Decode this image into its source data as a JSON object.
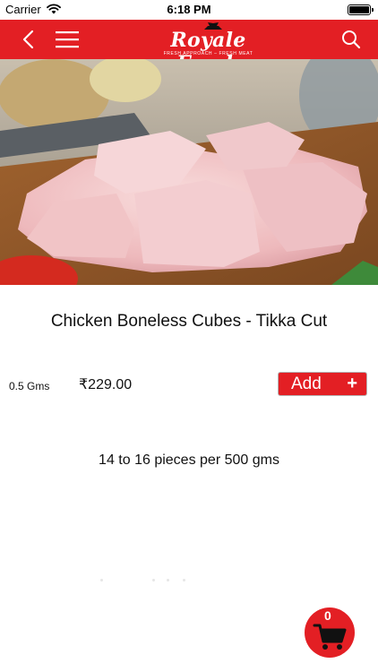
{
  "status_bar": {
    "carrier": "Carrier",
    "time": "6:18 PM"
  },
  "header": {
    "logo_title": "Royale Fresh",
    "logo_tagline": "FRESH APPROACH – FRESH MEAT",
    "icons": {
      "back": "chevron-left-icon",
      "menu": "hamburger-menu-icon",
      "search": "search-icon"
    }
  },
  "product": {
    "image_alt": "chicken-cubes-photo",
    "name": "Chicken Boneless Cubes - Tikka Cut",
    "weight": "0.5 Gms",
    "price": "₹229.00",
    "add_label": "Add",
    "add_symbol": "+",
    "description": "14 to 16 pieces per 500 gms"
  },
  "cart": {
    "count": "0",
    "icon": "shopping-cart-icon"
  },
  "colors": {
    "brand_red": "#e31f24",
    "text": "#111111",
    "background": "#ffffff"
  }
}
